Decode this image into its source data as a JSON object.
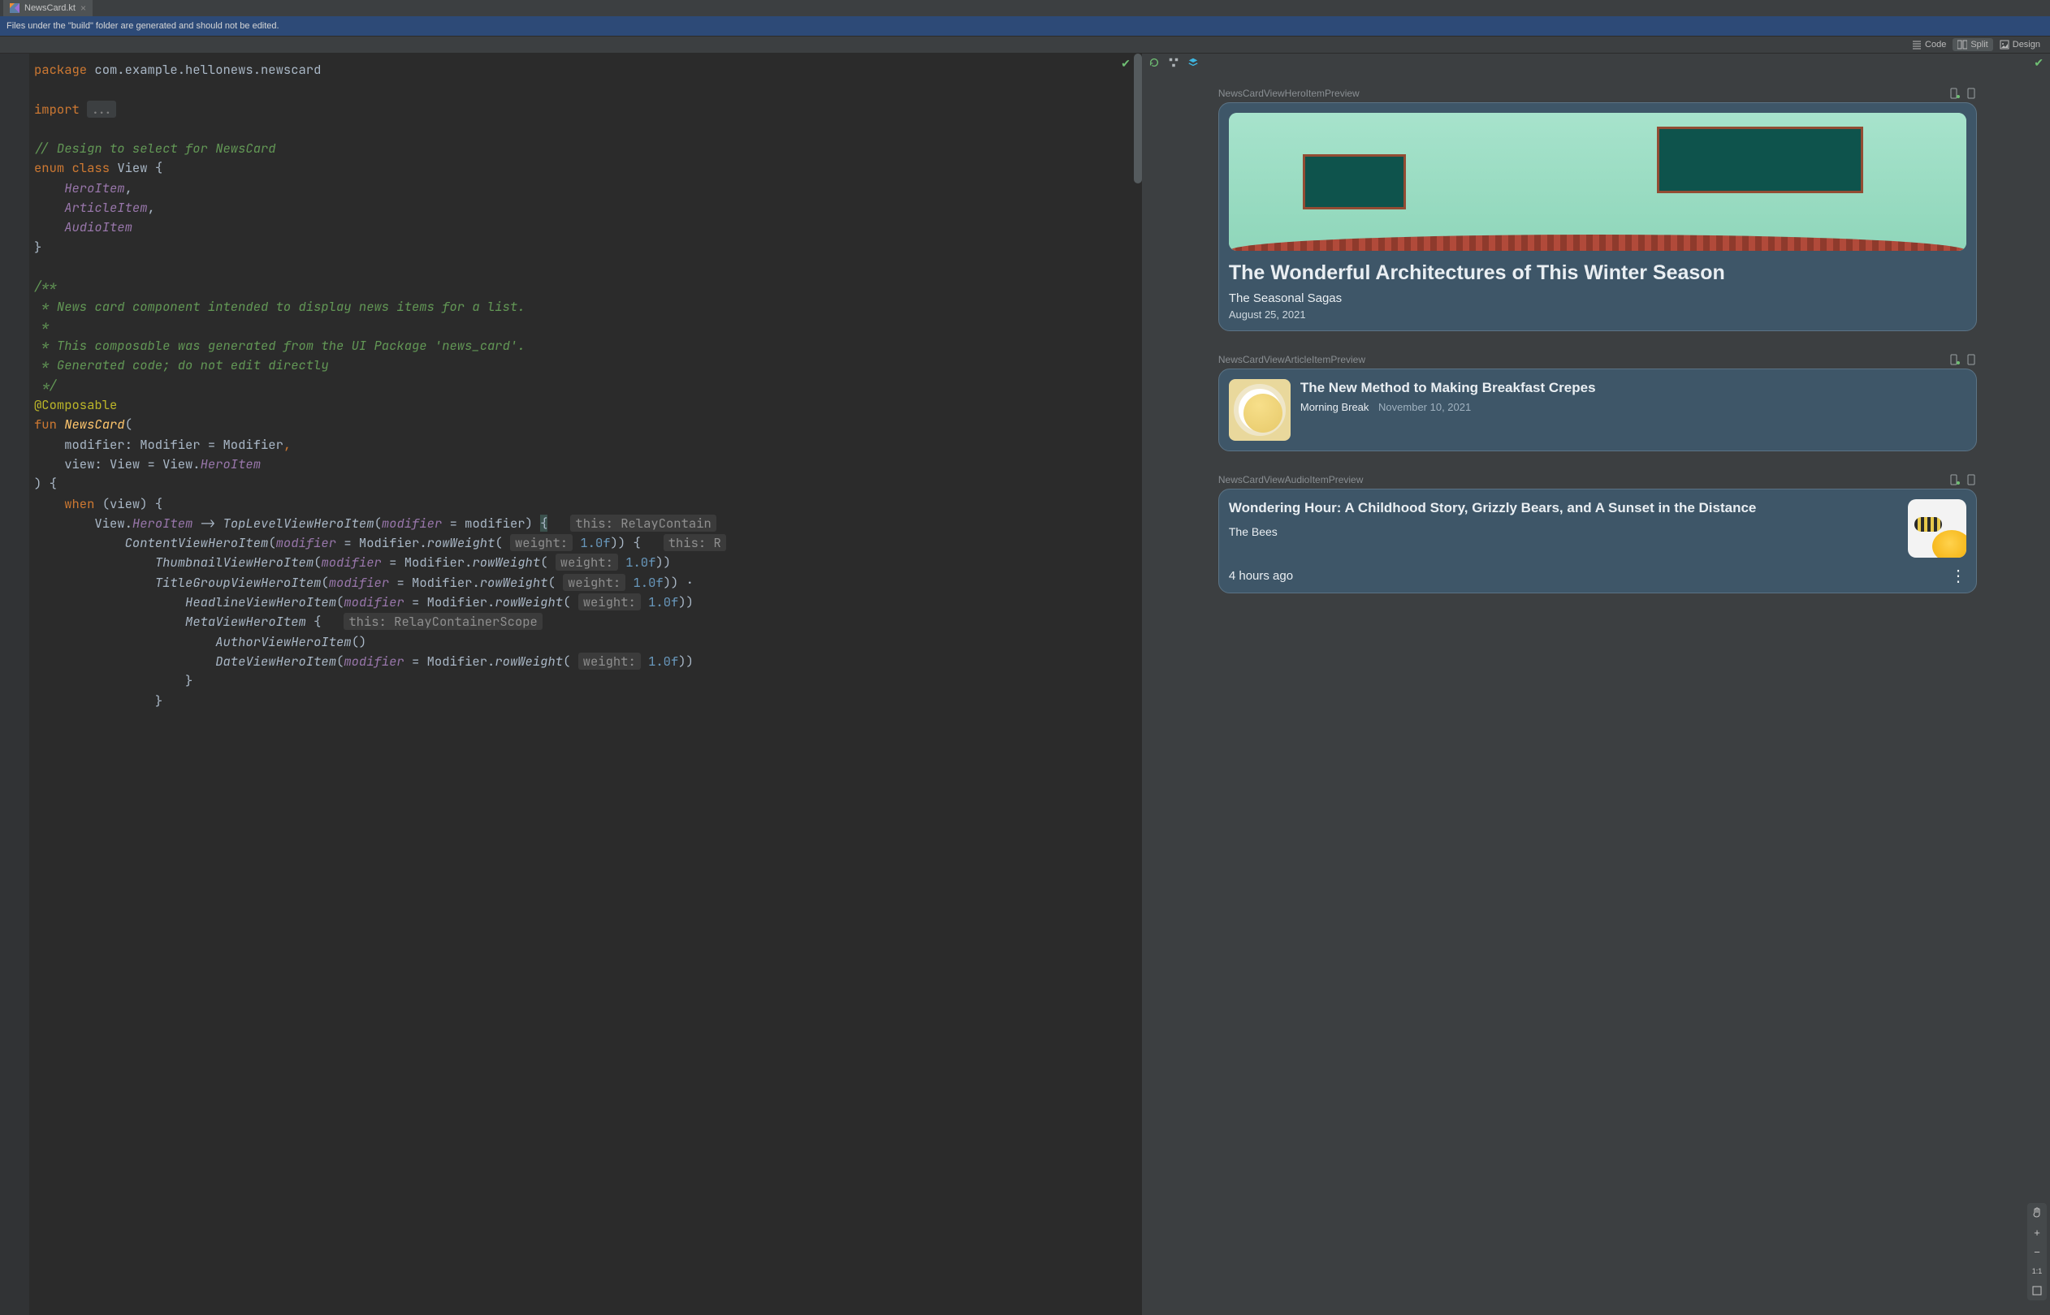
{
  "tab": {
    "filename": "NewsCard.kt"
  },
  "banner": {
    "text": "Files under the \"build\" folder are generated and should not be edited."
  },
  "modes": {
    "code": "Code",
    "split": "Split",
    "design": "Design",
    "active": "split"
  },
  "code": {
    "l1a": "package",
    "l1b": " com.example.hellonews.newscard",
    "l3a": "import",
    "l3b": "...",
    "l5": "// Design to select for NewsCard",
    "l6a": "enum class",
    "l6b": " View {",
    "l7": "HeroItem",
    "l7s": ",",
    "l8": "ArticleItem",
    "l8s": ",",
    "l9": "AudioItem",
    "l10": "}",
    "l12": "/**",
    "l13": " * News card component intended to display news items for a list.",
    "l14": " *",
    "l15": " * This composable was generated from the UI Package 'news_card'.",
    "l16": " * Generated code; do not edit directly",
    "l17": " */",
    "l18": "@Composable",
    "l19a": "fun",
    "l19b": " NewsCard",
    "l19c": "(",
    "l20a": "modifier: Modifier = Modifier",
    "l20b": ",",
    "l21a": "view: View = View.",
    "l21b": "HeroItem",
    "l22": ") {",
    "l23a": "when",
    "l23b": " (view) {",
    "l24a": "View.",
    "l24b": "HeroItem",
    "l24c": " -> ",
    "l24d": "TopLevelViewHeroItem",
    "l24e": "(",
    "l24f": "modifier",
    "l24g": " = modifier) ",
    "l24h": "{",
    "l24hint": "this: RelayContain",
    "l25a": "ContentViewHeroItem",
    "l25b": "(",
    "l25c": "modifier",
    "l25d": " = Modifier.",
    "l25e": "rowWeight",
    "l25f": "(",
    "l25hint": "weight:",
    "l25g": " 1.0f",
    "l25h": ")) {",
    "l25hint2": "this: R",
    "l26a": "ThumbnailViewHeroItem",
    "l26b": "(",
    "l26c": "modifier",
    "l26d": " = Modifier.",
    "l26e": "rowWeight",
    "l26f": "(",
    "l26hint": "weight:",
    "l26g": " 1.0f",
    "l26h": "))",
    "l27a": "TitleGroupViewHeroItem",
    "l27b": "(",
    "l27c": "modifier",
    "l27d": " = Modifier.",
    "l27e": "rowWeight",
    "l27f": "(",
    "l27hint": "weight:",
    "l27g": " 1.0f",
    "l27h": ")) ",
    "l28a": "HeadlineViewHeroItem",
    "l28b": "(",
    "l28c": "modifier",
    "l28d": " = Modifier.",
    "l28e": "rowWeight",
    "l28f": "(",
    "l28hint": "weight:",
    "l28g": " 1.0f",
    "l28h": "))",
    "l29a": "MetaViewHeroItem",
    "l29b": " {",
    "l29hint": "this: RelayContainerScope",
    "l30a": "AuthorViewHeroItem",
    "l30b": "()",
    "l31a": "DateViewHeroItem",
    "l31b": "(",
    "l31c": "modifier",
    "l31d": " = Modifier.",
    "l31e": "rowWeight",
    "l31f": "(",
    "l31hint": "weight:",
    "l31g": " 1.0f",
    "l31h": "))",
    "l32": "}",
    "l33": "}"
  },
  "previews": {
    "hero": {
      "label": "NewsCardViewHeroItemPreview",
      "title": "The Wonderful Architectures of This Winter Season",
      "author": "The Seasonal Sagas",
      "date": "August 25, 2021"
    },
    "article": {
      "label": "NewsCardViewArticleItemPreview",
      "title": "The New Method to Making Breakfast Crepes",
      "author": "Morning Break",
      "date": "November 10, 2021"
    },
    "audio": {
      "label": "NewsCardViewAudioItemPreview",
      "title": "Wondering Hour: A Childhood Story, Grizzly Bears, and A Sunset in the Distance",
      "author": "The Bees",
      "ago": "4 hours ago"
    }
  },
  "zoom": {
    "ratio": "1:1",
    "plus": "+",
    "minus": "−"
  }
}
